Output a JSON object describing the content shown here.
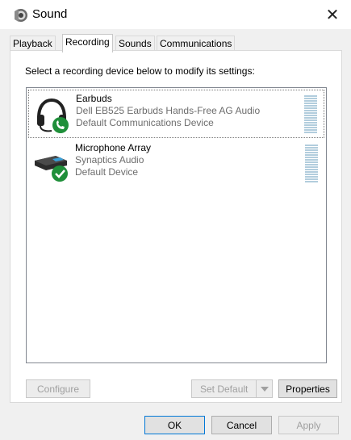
{
  "window": {
    "title": "Sound",
    "close_glyph": "✕"
  },
  "tabs": [
    {
      "label": "Playback",
      "active": false
    },
    {
      "label": "Recording",
      "active": true
    },
    {
      "label": "Sounds",
      "active": false
    },
    {
      "label": "Communications",
      "active": false
    }
  ],
  "panel": {
    "instruction": "Select a recording device below to modify its settings:",
    "devices": [
      {
        "name": "Earbuds",
        "description": "Dell EB525 Earbuds Hands-Free AG Audio",
        "status": "Default Communications Device",
        "icon": "headset-icon",
        "badge": "phone-badge-icon",
        "selected": true
      },
      {
        "name": "Microphone Array",
        "description": "Synaptics Audio",
        "status": "Default Device",
        "icon": "microphone-array-icon",
        "badge": "check-badge-icon",
        "selected": false
      }
    ],
    "buttons": {
      "configure": "Configure",
      "set_default": "Set Default",
      "properties": "Properties"
    }
  },
  "footer": {
    "ok": "OK",
    "cancel": "Cancel",
    "apply": "Apply"
  },
  "colors": {
    "accent": "#0078d7",
    "badge_green": "#1f8f3a",
    "meter": "#b2cddd"
  }
}
